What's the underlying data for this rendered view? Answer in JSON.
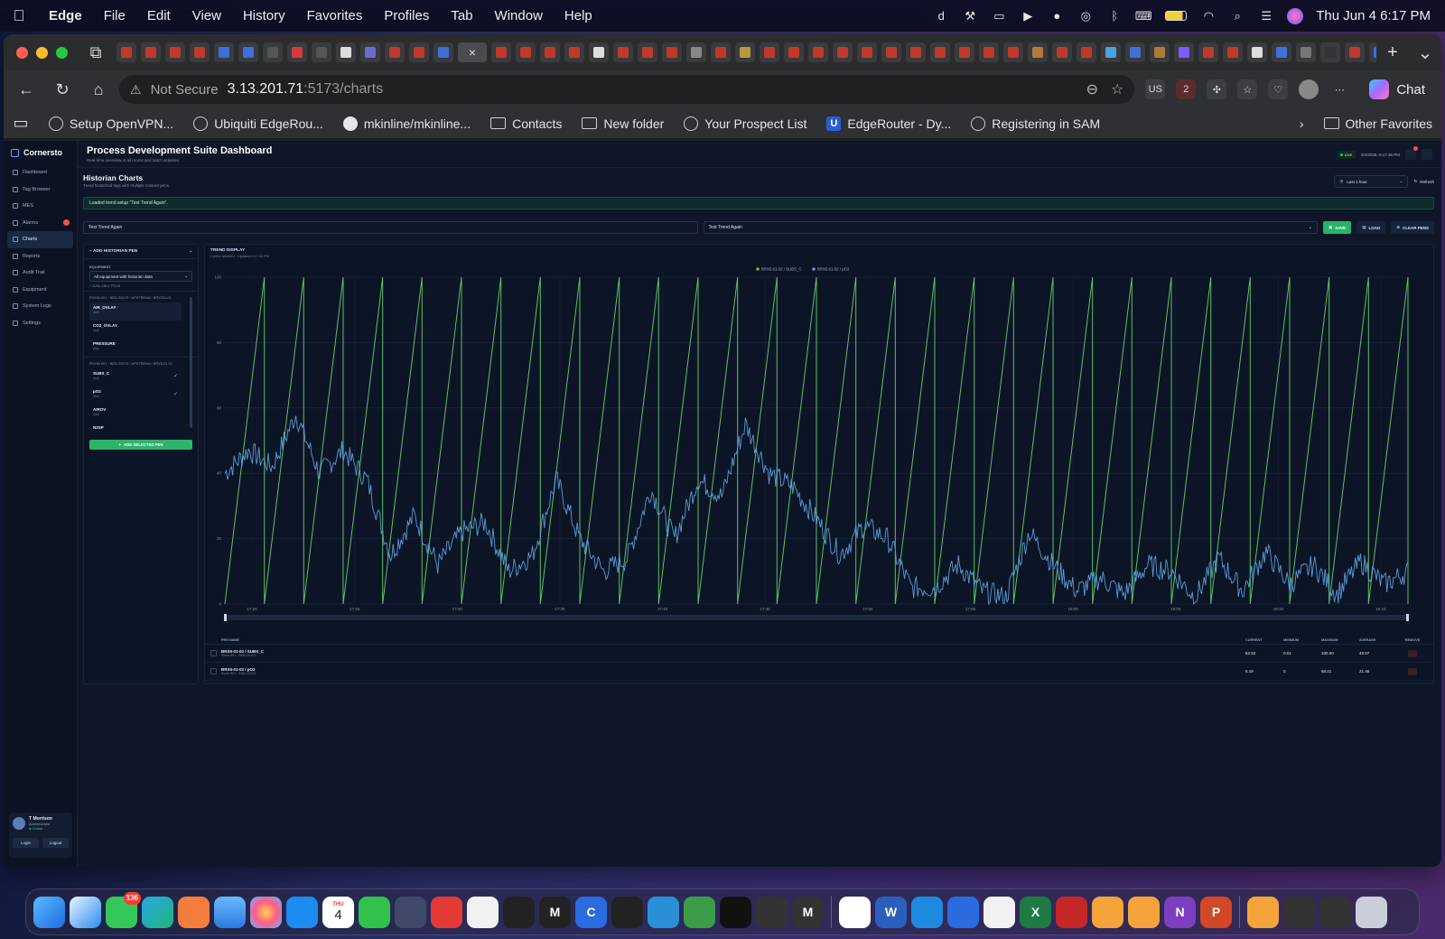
{
  "menubar": {
    "app_name": "Edge",
    "items": [
      "File",
      "Edit",
      "View",
      "History",
      "Favorites",
      "Profiles",
      "Tab",
      "Window",
      "Help"
    ],
    "clock": "Thu Jun 4  6:17 PM"
  },
  "browser": {
    "not_secure": "Not Secure",
    "url_host": "3.13.201.71",
    "url_path": ":5173/charts",
    "chat_label": "Chat",
    "favorites": [
      {
        "label": "Setup OpenVPN...",
        "icon": "globe-icon"
      },
      {
        "label": "Ubiquiti EdgeRou...",
        "icon": "globe-icon"
      },
      {
        "label": "mkinline/mkinline...",
        "icon": "github-icon"
      },
      {
        "label": "Contacts",
        "icon": "folder-icon"
      },
      {
        "label": "New folder",
        "icon": "folder-icon"
      },
      {
        "label": "Your Prospect List",
        "icon": "globe-icon"
      },
      {
        "label": "EdgeRouter - Dy...",
        "icon": "u-icon"
      },
      {
        "label": "Registering in SAM",
        "icon": "globe-icon"
      }
    ],
    "other_favorites": "Other Favorites"
  },
  "app": {
    "brand": "Cornersto",
    "nav": [
      {
        "label": "Dashboard",
        "active": false
      },
      {
        "label": "Tag Browser",
        "active": false
      },
      {
        "label": "MES",
        "active": false
      },
      {
        "label": "Alarms",
        "active": false,
        "badge": true
      },
      {
        "label": "Charts",
        "active": true
      },
      {
        "label": "Reports",
        "active": false
      },
      {
        "label": "Audit Trail",
        "active": false
      },
      {
        "label": "Equipment",
        "active": false
      },
      {
        "label": "System Logs",
        "active": false
      },
      {
        "label": "Settings",
        "active": false
      }
    ],
    "user": {
      "name": "T Morrison",
      "role": "Administrator",
      "status": "● Online",
      "login": "Login",
      "logout": "Logout"
    },
    "header": {
      "title": "Process Development Suite Dashboard",
      "subtitle": "Real-time overview of all rooms and batch activities",
      "live": "Live",
      "datetime": "6/4/2026, 6:17:38 PM"
    },
    "section": {
      "title": "Historian Charts",
      "subtitle": "Trend historized tags with multiple colored pens.",
      "range": "Last 1 hour",
      "refresh": "Refresh"
    },
    "banner": "Loaded trend setup \"Test Trend Again\".",
    "trend_bar": {
      "name_value": "Test Trend Again",
      "select_value": "Test Trend Again",
      "save": "SAVE",
      "load": "LOAD",
      "clear": "CLEAR PENS"
    },
    "left_panel": {
      "title": "ADD HISTORIAN PEN",
      "equipment_label": "EQUIPMENT",
      "equipment_value": "All equipment with historian data",
      "count": "7 AVAILABLE PENS",
      "groups": [
        {
          "room": "ROOM 801 · BIOLOGICS / UPSTREAM / BRX204-01",
          "pens": [
            {
              "name": "AIR_OVLAY",
              "unit": "mult",
              "checked": false
            },
            {
              "name": "CO2_OVLAY",
              "unit": "mult",
              "checked": false
            },
            {
              "name": "PRESSURE",
              "unit": "psig",
              "checked": false
            }
          ]
        },
        {
          "room": "ROOM 801 · BIOLOGICS / UPSTREAM / BRX5-01-02",
          "pens": [
            {
              "name": "SUBS_C",
              "unit": "mult",
              "checked": true
            },
            {
              "name": "pO2",
              "unit": "mult",
              "checked": true
            },
            {
              "name": "AIROV",
              "unit": "mult",
              "checked": false
            },
            {
              "name": "N2SP",
              "unit": "",
              "checked": false
            }
          ]
        }
      ],
      "add_button": "ADD SELECTED PEN"
    },
    "chart_panel": {
      "title": "TREND DISPLAY",
      "subtitle": "2 pens selected · Updated 6:17:41 PM"
    },
    "pen_table": {
      "headers": [
        "PEN NAME",
        "CURRENT",
        "MINIMUM",
        "MAXIMUM",
        "AVERAGE",
        "REMOVE"
      ],
      "rows": [
        {
          "name": "BRX5-01-02 / SUBS_C",
          "room": "Room 801 · BIOLOGICS",
          "current": "62.52",
          "min": "0.01",
          "max": "100.00",
          "avg": "49.87"
        },
        {
          "name": "BRX5-01-02 / pO2",
          "room": "Room 801 · BIOLOGICS",
          "current": "5.19",
          "min": "0",
          "max": "58.41",
          "avg": "21.46"
        }
      ]
    }
  },
  "chart_data": {
    "type": "line",
    "xlabel": "",
    "ylabel": "",
    "ylim": [
      0,
      100
    ],
    "yticks": [
      0,
      20,
      40,
      60,
      80,
      100
    ],
    "xticks": [
      "17:20",
      "17:25",
      "17:30",
      "17:35",
      "17:40",
      "17:45",
      "17:50",
      "17:55",
      "18:00",
      "18:05",
      "18:10",
      "18:15"
    ],
    "grid": true,
    "legend": "top-center",
    "series": [
      {
        "name": "BRX5-01-02 / SUBS_C",
        "color": "#5fbf6a",
        "pattern": "sawtooth",
        "min": 0.01,
        "max": 100.0,
        "cycles": 30
      },
      {
        "name": "BRX5-01-02 / pO2",
        "color": "#5b9bd5",
        "keypoints": [
          [
            0,
            40
          ],
          [
            2,
            47
          ],
          [
            4,
            42
          ],
          [
            6,
            58
          ],
          [
            8,
            40
          ],
          [
            10,
            47
          ],
          [
            12,
            38
          ],
          [
            14,
            15
          ],
          [
            16,
            27
          ],
          [
            18,
            12
          ],
          [
            20,
            22
          ],
          [
            22,
            25
          ],
          [
            24,
            10
          ],
          [
            26,
            15
          ],
          [
            28,
            38
          ],
          [
            30,
            20
          ],
          [
            32,
            10
          ],
          [
            34,
            14
          ],
          [
            36,
            35
          ],
          [
            38,
            20
          ],
          [
            40,
            38
          ],
          [
            42,
            33
          ],
          [
            44,
            55
          ],
          [
            46,
            40
          ],
          [
            48,
            36
          ],
          [
            50,
            26
          ],
          [
            52,
            15
          ],
          [
            54,
            24
          ],
          [
            56,
            20
          ],
          [
            58,
            5
          ],
          [
            60,
            5
          ],
          [
            62,
            12
          ],
          [
            64,
            4
          ],
          [
            66,
            2
          ],
          [
            68,
            22
          ],
          [
            70,
            12
          ],
          [
            72,
            4
          ],
          [
            74,
            8
          ],
          [
            76,
            3
          ],
          [
            78,
            12
          ],
          [
            80,
            10
          ],
          [
            82,
            2
          ],
          [
            84,
            14
          ],
          [
            86,
            4
          ],
          [
            88,
            16
          ],
          [
            90,
            6
          ],
          [
            92,
            12
          ],
          [
            94,
            3
          ],
          [
            96,
            13
          ],
          [
            98,
            6
          ],
          [
            100,
            10
          ]
        ]
      }
    ]
  },
  "dock": {
    "messages_badge": "136",
    "calendar_day": "4",
    "calendar_month": "THU"
  }
}
